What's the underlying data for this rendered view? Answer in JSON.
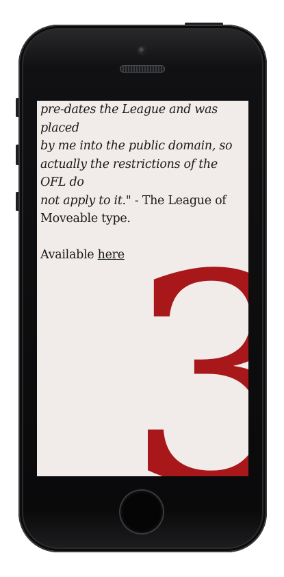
{
  "article": {
    "quote_line_1": "pre-dates the League and was placed",
    "quote_line_2": "by me into the public domain, so",
    "quote_line_3": "actually the restrictions of the OFL do",
    "quote_line_4": "not apply to it.\"",
    "attribution_part1": " - The League of",
    "attribution_part2": "Moveable type.",
    "available_label": "Available ",
    "available_link": "here",
    "big_numeral": "3"
  },
  "colors": {
    "screen_bg": "#f1ecea",
    "numeral": "#a8171a",
    "phone_body": "#0a0a0b"
  },
  "icons": {
    "camera": "front-camera-icon",
    "speaker": "earpiece-speaker-icon",
    "home": "home-button-icon"
  }
}
